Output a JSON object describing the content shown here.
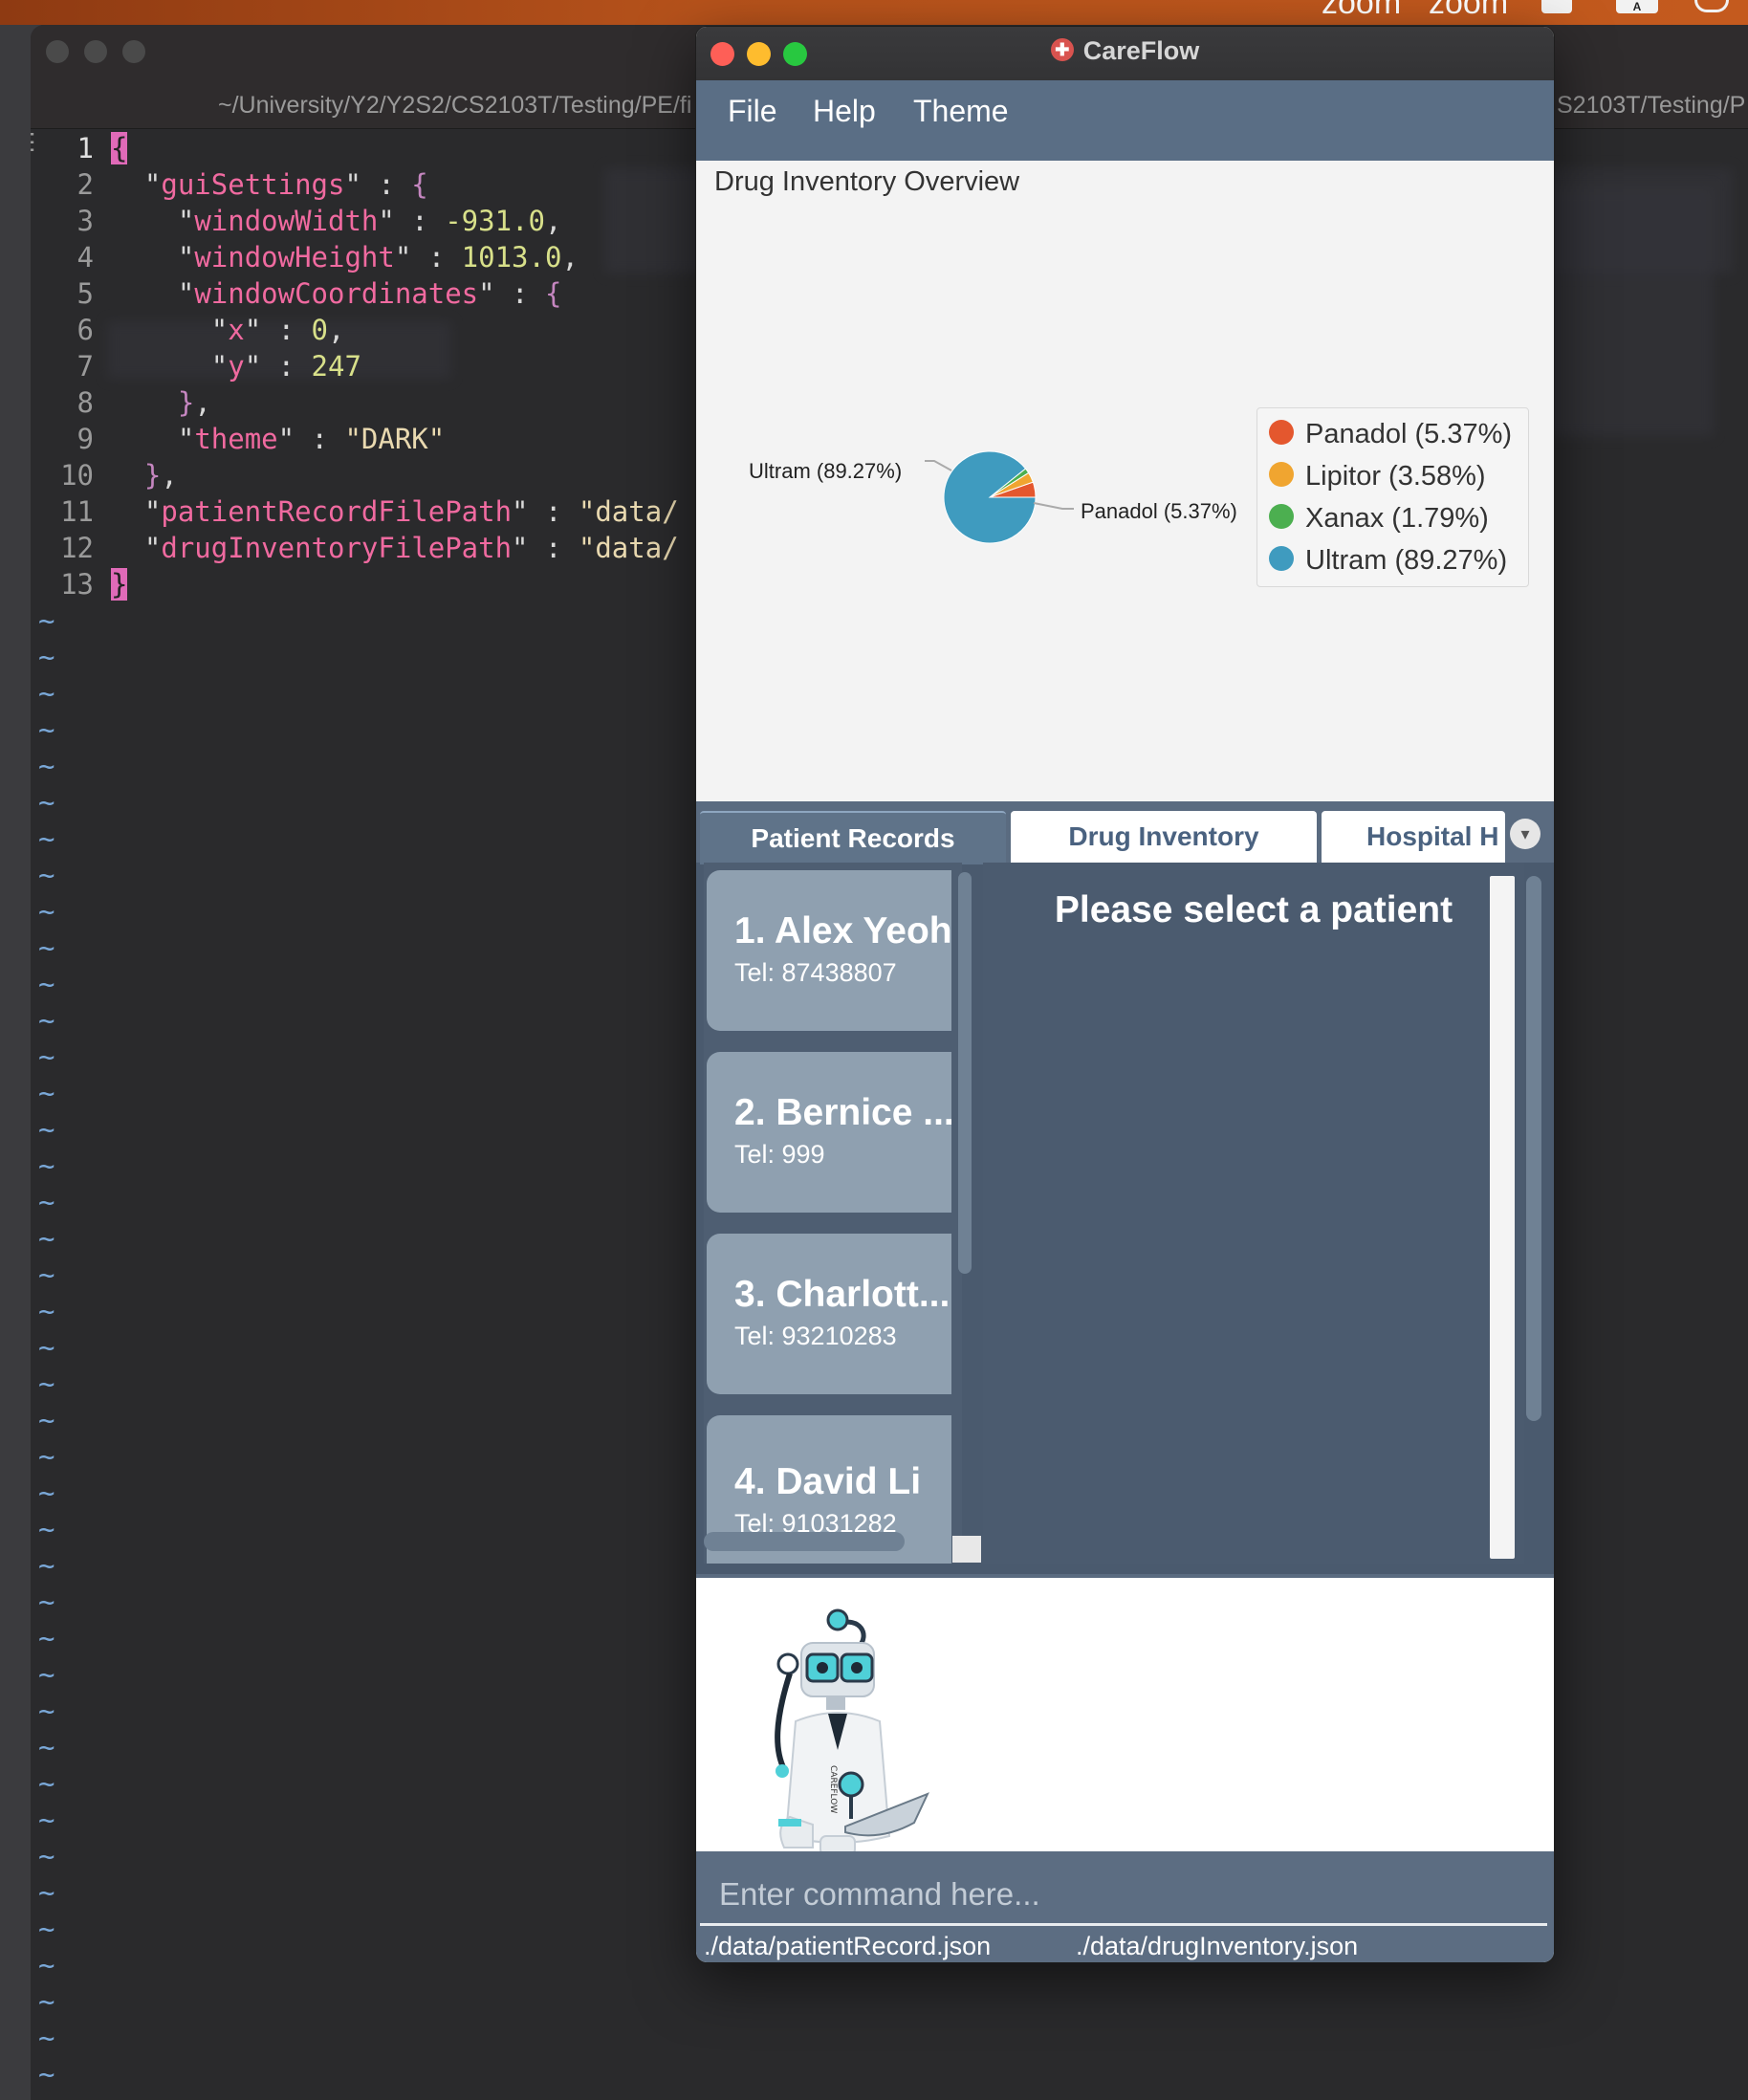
{
  "menubar": {
    "zoom_1": "zoom",
    "zoom_2": "zoom",
    "icon_letter": "A"
  },
  "editor": {
    "path_left": "~/University/Y2/Y2S2/CS2103T/Testing/PE/fi",
    "path_right": "S2103T/Testing/P",
    "lines": [
      {
        "n": "1",
        "parts": [
          [
            "cursor",
            "{"
          ]
        ]
      },
      {
        "n": "2",
        "parts": [
          [
            "p",
            "  \""
          ],
          [
            "k",
            "guiSettings"
          ],
          [
            "p",
            "\" : "
          ],
          [
            "br",
            "{"
          ]
        ]
      },
      {
        "n": "3",
        "parts": [
          [
            "p",
            "    \""
          ],
          [
            "k",
            "windowWidth"
          ],
          [
            "p",
            "\" : "
          ],
          [
            "n",
            "-931.0"
          ],
          [
            "p",
            ","
          ]
        ]
      },
      {
        "n": "4",
        "parts": [
          [
            "p",
            "    \""
          ],
          [
            "k",
            "windowHeight"
          ],
          [
            "p",
            "\" : "
          ],
          [
            "n",
            "1013.0"
          ],
          [
            "p",
            ","
          ]
        ]
      },
      {
        "n": "5",
        "parts": [
          [
            "p",
            "    \""
          ],
          [
            "k",
            "windowCoordinates"
          ],
          [
            "p",
            "\" : "
          ],
          [
            "br",
            "{"
          ]
        ]
      },
      {
        "n": "6",
        "parts": [
          [
            "p",
            "      \""
          ],
          [
            "k",
            "x"
          ],
          [
            "p",
            "\" : "
          ],
          [
            "n",
            "0"
          ],
          [
            "p",
            ","
          ]
        ]
      },
      {
        "n": "7",
        "parts": [
          [
            "p",
            "      \""
          ],
          [
            "k",
            "y"
          ],
          [
            "p",
            "\" : "
          ],
          [
            "n",
            "247"
          ]
        ]
      },
      {
        "n": "8",
        "parts": [
          [
            "p",
            "    "
          ],
          [
            "br",
            "}"
          ],
          [
            "p",
            ","
          ]
        ]
      },
      {
        "n": "9",
        "parts": [
          [
            "p",
            "    \""
          ],
          [
            "k",
            "theme"
          ],
          [
            "p",
            "\" : "
          ],
          [
            "s",
            "\"DARK\""
          ]
        ]
      },
      {
        "n": "10",
        "parts": [
          [
            "p",
            "  "
          ],
          [
            "br",
            "}"
          ],
          [
            "p",
            ","
          ]
        ]
      },
      {
        "n": "11",
        "parts": [
          [
            "p",
            "  \""
          ],
          [
            "k",
            "patientRecordFilePath"
          ],
          [
            "p",
            "\" : "
          ],
          [
            "s",
            "\"data/"
          ]
        ]
      },
      {
        "n": "12",
        "parts": [
          [
            "p",
            "  \""
          ],
          [
            "k",
            "drugInventoryFilePath"
          ],
          [
            "p",
            "\" : "
          ],
          [
            "s",
            "\"data/"
          ]
        ]
      },
      {
        "n": "13",
        "parts": [
          [
            "cursor",
            "}"
          ]
        ]
      }
    ],
    "tilde": "~"
  },
  "careflow": {
    "title": "CareFlow",
    "menu": [
      "File",
      "Help",
      "Theme"
    ],
    "overview_title": "Drug Inventory Overview",
    "chart_data": {
      "type": "pie",
      "categories": [
        "Panadol",
        "Lipitor",
        "Xanax",
        "Ultram"
      ],
      "values": [
        5.37,
        3.58,
        1.79,
        89.27
      ],
      "colors": [
        "#e4572e",
        "#f0a530",
        "#4caf50",
        "#3f9bbf"
      ],
      "legend": [
        "Panadol (5.37%)",
        "Lipitor (3.58%)",
        "Xanax (1.79%)",
        "Ultram (89.27%)"
      ],
      "slice_labels": {
        "ultram": "Ultram (89.27%)",
        "panadol": "Panadol (5.37%)"
      },
      "legend_position": "right"
    },
    "tabs": [
      "Patient Records",
      "Drug Inventory",
      "Hospital H"
    ],
    "patients": [
      {
        "name": "1.  Alex Yeoh",
        "tel": "Tel: 87438807"
      },
      {
        "name": "2.  Bernice ...",
        "tel": "Tel: 999"
      },
      {
        "name": "3.  Charlott...",
        "tel": "Tel: 93210283"
      },
      {
        "name": "4.  David Li",
        "tel": "Tel: 91031282"
      }
    ],
    "detail_text": "Please select a patient",
    "command_placeholder": "Enter command here...",
    "status_patient": "./data/patientRecord.json",
    "status_drug": "./data/drugInventory.json",
    "mascot_text": "CAREFLOW"
  }
}
